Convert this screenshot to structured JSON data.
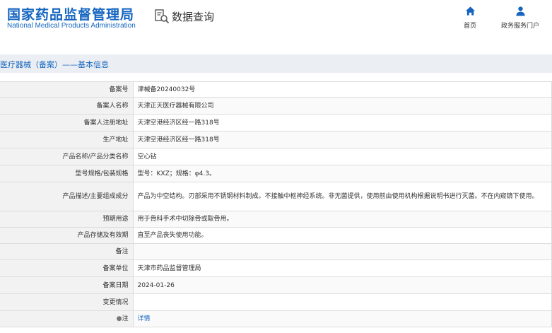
{
  "header": {
    "site_title_cn": "国家药品监督管理局",
    "site_title_en": "National Medical Products Administration",
    "query_label": "数据查询",
    "nav": [
      {
        "label": "首页",
        "icon": "home-icon"
      },
      {
        "label": "政务服务门户",
        "icon": "user-icon"
      }
    ]
  },
  "breadcrumb": "医疗器械（备案）——基本信息",
  "colors": {
    "brand": "#1565c0",
    "label_bg": "#f2f2f2",
    "bar_bg": "#ebeef2",
    "border": "#dcdcdc"
  },
  "records": [
    {
      "label": "备案号",
      "value": "津械备20240032号"
    },
    {
      "label": "备案人名称",
      "value": "天津正天医疗器械有限公司"
    },
    {
      "label": "备案人注册地址",
      "value": "天津空港经济区经一路318号"
    },
    {
      "label": "生产地址",
      "value": "天津空港经济区经一路318号"
    },
    {
      "label": "产品名称/产品分类名称",
      "value": "空心钻"
    },
    {
      "label": "型号规格/包装规格",
      "value": "型号：KXZ；规格：φ4.3。"
    },
    {
      "label": "产品描述/主要组成成分",
      "value": "产品为中空结构。刃部采用不锈钢材料制成。不接触中枢神经系统。非无菌提供，使用前由使用机构根据说明书进行灭菌。不在内窥镜下使用。"
    },
    {
      "label": "预期用途",
      "value": "用于骨科手术中切除骨或取骨用。"
    },
    {
      "label": "产品存储及有效期",
      "value": "直至产品丧失使用功能。"
    },
    {
      "label": "备注",
      "value": ""
    },
    {
      "label": "备案单位",
      "value": "天津市药品监督管理局"
    },
    {
      "label": "备案日期",
      "value": "2024-01-26"
    },
    {
      "label": "变更情况",
      "value": ""
    },
    {
      "label": "注",
      "value": "详情",
      "note_marker": "●"
    }
  ]
}
